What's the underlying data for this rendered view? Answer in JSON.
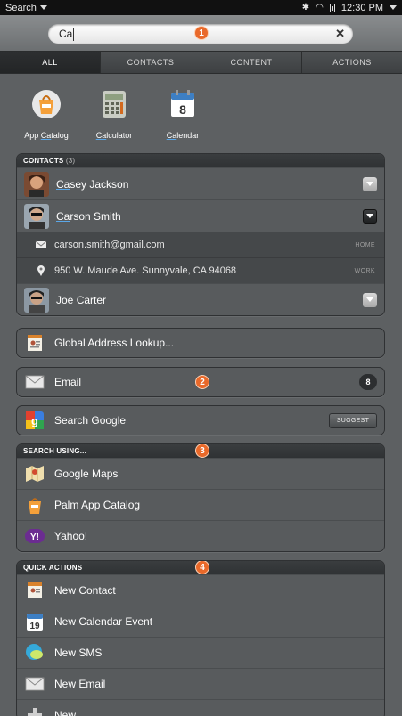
{
  "status_bar": {
    "app_menu_label": "Search",
    "time": "12:30 PM"
  },
  "search": {
    "query": "Ca"
  },
  "badges": [
    "1",
    "2",
    "3",
    "4"
  ],
  "tabs": [
    {
      "label": "ALL",
      "active": true
    },
    {
      "label": "CONTACTS",
      "active": false
    },
    {
      "label": "CONTENT",
      "active": false
    },
    {
      "label": "ACTIONS",
      "active": false
    }
  ],
  "apps": [
    {
      "label_hl": "Ca",
      "label_rest": "talog",
      "label_prefix": "App ",
      "icon": "app-catalog-icon"
    },
    {
      "label_hl": "Ca",
      "label_rest": "lculator",
      "label_prefix": "",
      "icon": "calculator-icon"
    },
    {
      "label_hl": "Ca",
      "label_rest": "lendar",
      "label_prefix": "",
      "icon": "calendar-icon",
      "icon_text": "8"
    }
  ],
  "contacts": {
    "header": "CONTACTS",
    "count": "(3)",
    "items": [
      {
        "hl": "Ca",
        "rest": "sey Jackson",
        "prefix": ""
      },
      {
        "hl": "Ca",
        "rest": "rson Smith",
        "prefix": ""
      },
      {
        "hl": "Ca",
        "rest": "rter",
        "prefix": "Joe "
      }
    ],
    "details": [
      {
        "text": "carson.smith@gmail.com",
        "tag": "HOME",
        "icon": "envelope-icon"
      },
      {
        "text": "950 W. Maude Ave. Sunnyvale, CA 94068",
        "tag": "WORK",
        "icon": "map-pin-icon"
      }
    ]
  },
  "global_lookup": {
    "label": "Global Address Lookup..."
  },
  "email": {
    "label": "Email",
    "count": "8"
  },
  "search_google": {
    "label": "Search Google",
    "button": "SUGGEST"
  },
  "search_using": {
    "header": "SEARCH USING...",
    "items": [
      {
        "label": "Google Maps",
        "icon": "google-maps-icon"
      },
      {
        "label": "Palm App Catalog",
        "icon": "palm-app-catalog-icon"
      },
      {
        "label": "Yahoo!",
        "icon": "yahoo-icon"
      }
    ]
  },
  "quick_actions": {
    "header": "QUICK ACTIONS",
    "items": [
      {
        "label": "New Contact",
        "icon": "new-contact-icon"
      },
      {
        "label": "New Calendar Event",
        "icon": "calendar-event-icon",
        "icon_text": "19"
      },
      {
        "label": "New SMS",
        "icon": "sms-icon"
      },
      {
        "label": "New Email",
        "icon": "envelope-icon"
      },
      {
        "label": "New...",
        "icon": "plus-icon"
      }
    ]
  }
}
